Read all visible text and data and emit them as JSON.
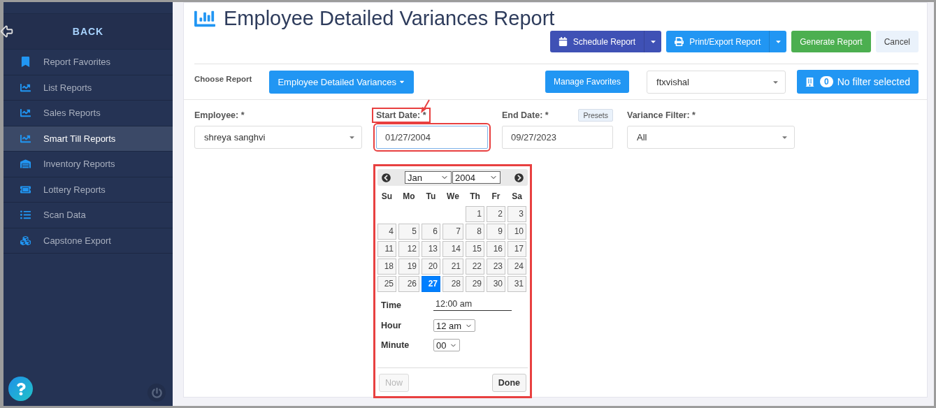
{
  "sidebar": {
    "back_label": "BACK",
    "items": [
      {
        "label": "Report Favorites",
        "kind": "bookmark",
        "selected": false
      },
      {
        "label": "List Reports",
        "kind": "chart",
        "selected": false
      },
      {
        "label": "Sales Reports",
        "kind": "chart",
        "selected": false
      },
      {
        "label": "Smart Till Reports",
        "kind": "chart",
        "selected": true
      },
      {
        "label": "Inventory Reports",
        "kind": "inventory",
        "selected": false
      },
      {
        "label": "Lottery Reports",
        "kind": "ticket",
        "selected": false
      },
      {
        "label": "Scan Data",
        "kind": "list",
        "selected": false
      },
      {
        "label": "Capstone Export",
        "kind": "cubes",
        "selected": false
      }
    ]
  },
  "page": {
    "title": "Employee Detailed Variances Report"
  },
  "actions": [
    {
      "label": "Schedule Report",
      "kind": "schedule"
    },
    {
      "label": "Print/Export Report",
      "kind": "print"
    },
    {
      "label": "Generate Report",
      "kind": "generate"
    },
    {
      "label": "Cancel",
      "kind": "cancel"
    }
  ],
  "choose_report": {
    "label": "Choose Report",
    "value": "Employee Detailed Variances",
    "manage_label": "Manage Favorites",
    "user": "ftxvishal",
    "filter_count": "0",
    "filter_label": "No filter selected"
  },
  "fields": [
    {
      "label": "Employee: *",
      "value": "shreya sanghvi",
      "kind": "select"
    },
    {
      "label": "Start Date: *",
      "value": "01/27/2004",
      "kind": "date",
      "highlighted": true
    },
    {
      "label": "End Date: *",
      "value": "09/27/2023",
      "kind": "date",
      "presets": "Presets",
      "highlighted": false
    },
    {
      "label": "Variance Filter: *",
      "value": "All",
      "kind": "select"
    }
  ],
  "calendar": {
    "month": "Jan",
    "year": "2004",
    "weekdays": [
      "Su",
      "Mo",
      "Tu",
      "We",
      "Th",
      "Fr",
      "Sa"
    ],
    "weeks": [
      [
        {
          "kind": "blank"
        },
        {
          "kind": "blank"
        },
        {
          "kind": "blank"
        },
        {
          "kind": "blank"
        },
        {
          "kind": "day",
          "label": "1",
          "selected": false
        },
        {
          "kind": "day",
          "label": "2",
          "selected": false
        },
        {
          "kind": "day",
          "label": "3",
          "selected": false
        }
      ],
      [
        {
          "kind": "day",
          "label": "4",
          "selected": false
        },
        {
          "kind": "day",
          "label": "5",
          "selected": false
        },
        {
          "kind": "day",
          "label": "6",
          "selected": false
        },
        {
          "kind": "day",
          "label": "7",
          "selected": false
        },
        {
          "kind": "day",
          "label": "8",
          "selected": false
        },
        {
          "kind": "day",
          "label": "9",
          "selected": false
        },
        {
          "kind": "day",
          "label": "10",
          "selected": false
        }
      ],
      [
        {
          "kind": "day",
          "label": "11",
          "selected": false
        },
        {
          "kind": "day",
          "label": "12",
          "selected": false
        },
        {
          "kind": "day",
          "label": "13",
          "selected": false
        },
        {
          "kind": "day",
          "label": "14",
          "selected": false
        },
        {
          "kind": "day",
          "label": "15",
          "selected": false
        },
        {
          "kind": "day",
          "label": "16",
          "selected": false
        },
        {
          "kind": "day",
          "label": "17",
          "selected": false
        }
      ],
      [
        {
          "kind": "day",
          "label": "18",
          "selected": false
        },
        {
          "kind": "day",
          "label": "19",
          "selected": false
        },
        {
          "kind": "day",
          "label": "20",
          "selected": false
        },
        {
          "kind": "day",
          "label": "21",
          "selected": false
        },
        {
          "kind": "day",
          "label": "22",
          "selected": false
        },
        {
          "kind": "day",
          "label": "23",
          "selected": false
        },
        {
          "kind": "day",
          "label": "24",
          "selected": false
        }
      ],
      [
        {
          "kind": "day",
          "label": "25",
          "selected": false
        },
        {
          "kind": "day",
          "label": "26",
          "selected": false
        },
        {
          "kind": "day",
          "label": "27",
          "selected": true
        },
        {
          "kind": "day",
          "label": "28",
          "selected": false
        },
        {
          "kind": "day",
          "label": "29",
          "selected": false
        },
        {
          "kind": "day",
          "label": "30",
          "selected": false
        },
        {
          "kind": "day",
          "label": "31",
          "selected": false
        }
      ]
    ],
    "time_label": "Time",
    "time_value": "12:00 am",
    "hour_label": "Hour",
    "hour_value": "12 am",
    "minute_label": "Minute",
    "minute_value": "00",
    "now_label": "Now",
    "now_disabled": true,
    "done_label": "Done",
    "highlighted": true
  }
}
